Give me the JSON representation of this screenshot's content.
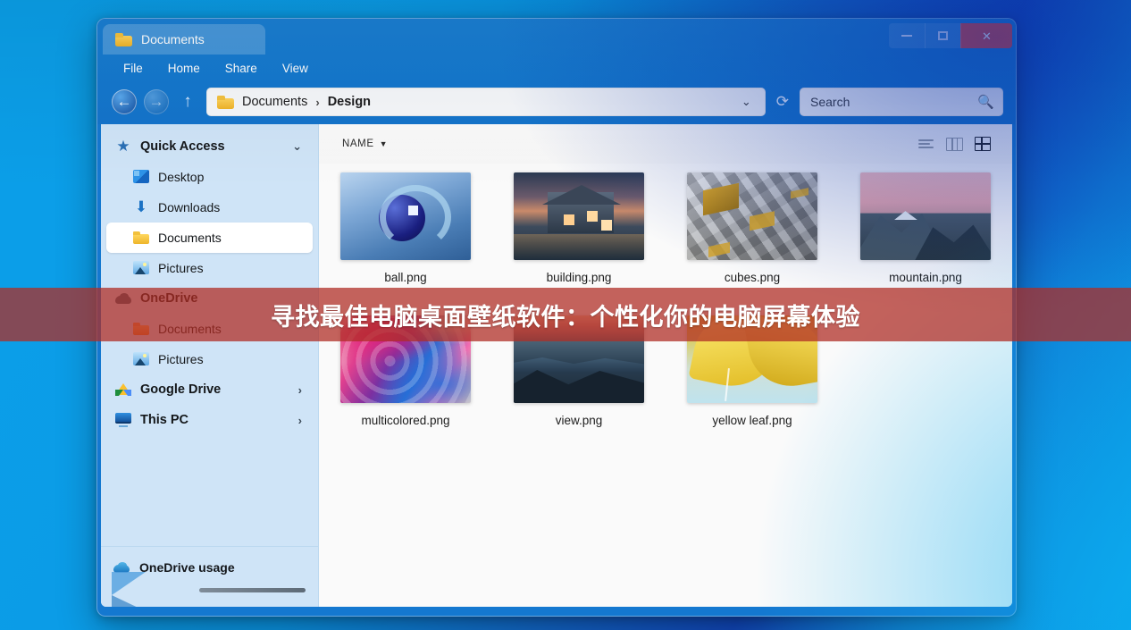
{
  "window": {
    "tab_title": "Documents",
    "controls": {
      "minimize": "—",
      "maximize": "▢",
      "close": "✕"
    },
    "menu": [
      "File",
      "Home",
      "Share",
      "View"
    ],
    "address": {
      "root": "Documents",
      "separator": "›",
      "current": "Design",
      "dropdown_icon": "chevron-down",
      "refresh_icon": "⟳"
    },
    "search": {
      "placeholder": "Search",
      "icon": "search-icon"
    }
  },
  "sidebar": {
    "quick_access": {
      "label": "Quick Access",
      "icon": "star-icon",
      "caret": "⌄"
    },
    "items": [
      {
        "label": "Desktop",
        "icon": "desktop-icon",
        "indent": true,
        "selected": false
      },
      {
        "label": "Downloads",
        "icon": "download-icon",
        "indent": true,
        "selected": false
      },
      {
        "label": "Documents",
        "icon": "folder-icon",
        "indent": true,
        "selected": true
      },
      {
        "label": "Pictures",
        "icon": "picture-icon",
        "indent": true,
        "selected": false
      }
    ],
    "onedrive": {
      "label": "OneDrive",
      "icon": "cloud-icon"
    },
    "onedrive_children": [
      {
        "label": "Documents",
        "icon": "folder-orange-icon"
      },
      {
        "label": "Pictures",
        "icon": "picture-icon"
      }
    ],
    "google_drive": {
      "label": "Google Drive",
      "icon": "google-drive-icon",
      "caret": "›"
    },
    "this_pc": {
      "label": "This PC",
      "icon": "pc-icon",
      "caret": "›"
    },
    "usage": {
      "label": "OneDrive usage",
      "icon": "cloud-blue-icon",
      "progress_percent": 100
    }
  },
  "content": {
    "sort": {
      "label": "NAME",
      "arrow": "▼"
    },
    "view_modes": [
      {
        "name": "list-view-icon",
        "active": false
      },
      {
        "name": "columns-view-icon",
        "active": false
      },
      {
        "name": "grid-view-icon",
        "active": true
      }
    ],
    "files": [
      {
        "name": "ball.png",
        "thumb": "t-ball"
      },
      {
        "name": "building.png",
        "thumb": "t-building"
      },
      {
        "name": "cubes.png",
        "thumb": "t-cubes"
      },
      {
        "name": "mountain.png",
        "thumb": "t-mountain"
      },
      {
        "name": "multicolored.png",
        "thumb": "t-multi"
      },
      {
        "name": "view.png",
        "thumb": "t-view"
      },
      {
        "name": "yellow leaf.png",
        "thumb": "t-leaf"
      }
    ]
  },
  "banner": {
    "text": "寻找最佳电脑桌面壁纸软件：个性化你的电脑屏幕体验",
    "background_color": "#b02c24",
    "text_color": "#ffffff"
  },
  "colors": {
    "desktop_blue": "#0b9ce7",
    "desktop_deep_blue": "#1148bc",
    "window_chrome": "#1579cf",
    "sidebar": "#cfe4f7",
    "close_button": "#e1453c"
  }
}
